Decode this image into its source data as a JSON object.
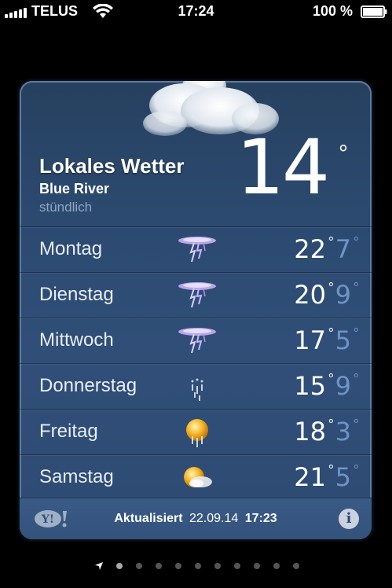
{
  "status_bar": {
    "carrier": "TELUS",
    "time": "17:24",
    "battery_percent": "100 %",
    "battery_level": 1.0
  },
  "weather": {
    "title": "Lokales Wetter",
    "city": "Blue River",
    "mode": "stündlich",
    "current_temp": "14",
    "degree": "°",
    "forecast": [
      {
        "day": "Montag",
        "icon": "thunderstorm-icon",
        "high": "22",
        "low": "7"
      },
      {
        "day": "Dienstag",
        "icon": "thunderstorm-icon",
        "high": "20",
        "low": "9"
      },
      {
        "day": "Mittwoch",
        "icon": "thunderstorm-icon",
        "high": "17",
        "low": "5"
      },
      {
        "day": "Donnerstag",
        "icon": "rain-icon",
        "high": "15",
        "low": "9"
      },
      {
        "day": "Freitag",
        "icon": "sun-showers-icon",
        "high": "18",
        "low": "3"
      },
      {
        "day": "Samstag",
        "icon": "partly-cloudy-icon",
        "high": "21",
        "low": "5"
      }
    ]
  },
  "footer": {
    "updated_label": "Aktualisiert",
    "updated_date": "22.09.14",
    "updated_time": "17:23",
    "logo": "Y!"
  },
  "pager": {
    "page_count": 11,
    "current_page": 0
  },
  "colors": {
    "background": "#000000",
    "card": "#2c4a70",
    "low_temp": "#6e93c8"
  }
}
